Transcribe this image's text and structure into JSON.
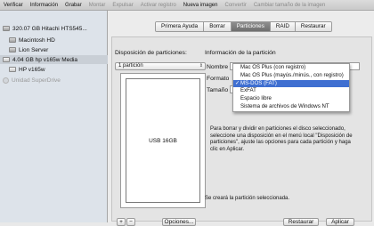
{
  "toolbar": {
    "items": [
      {
        "label": "Verificar",
        "enabled": true
      },
      {
        "label": "Información",
        "enabled": true
      },
      {
        "label": "Grabar",
        "enabled": true
      },
      {
        "label": "Montar",
        "enabled": false
      },
      {
        "label": "Expulsar",
        "enabled": false
      },
      {
        "label": "Activar registro",
        "enabled": false
      },
      {
        "label": "Nueva imagen",
        "enabled": true
      },
      {
        "label": "Convertir",
        "enabled": false
      },
      {
        "label": "Cambiar tamaño de la imagen",
        "enabled": false
      }
    ]
  },
  "sidebar": {
    "items": [
      {
        "label": "320.07 GB Hitachi HTS545...",
        "icon": "hard-disk-icon"
      },
      {
        "label": "Macintosh HD",
        "icon": "volume-icon"
      },
      {
        "label": "Lion Server",
        "icon": "volume-icon"
      },
      {
        "label": "4.04 GB hp v165w Media",
        "icon": "usb-drive-icon"
      },
      {
        "label": "HP v165w",
        "icon": "volume-icon"
      },
      {
        "label": "Unidad SuperDrive",
        "icon": "optical-drive-icon"
      }
    ]
  },
  "tabs": [
    "Primera Ayuda",
    "Borrar",
    "Particiones",
    "RAID",
    "Restaurar"
  ],
  "partition": {
    "layout_heading": "Disposición de particiones:",
    "layout_value": "1 partición",
    "partition_label": "USB 16GB",
    "info_heading": "Información de la partición",
    "name_label": "Nombre",
    "format_label": "Formato",
    "size_label": "Tamaño",
    "description": "Para borrar y dividir en particiones el disco seleccionado, seleccione una disposición en el menú local \"Disposición de particiones\", ajuste las opciones para cada partición y haga clic en Aplicar.",
    "status": "Se creará la partición seleccionada.",
    "add_label": "+",
    "remove_label": "−",
    "options_label": "Opciones...",
    "revert_label": "Restaurar",
    "apply_label": "Aplicar"
  },
  "format_menu": {
    "items": [
      "Mac OS Plus (con registro)",
      "Mac OS Plus (mayús./minús., con registro)",
      "MS-DOS (FAT)",
      "ExFAT",
      "Espacio libre",
      "Sistema de archivos de Windows NT"
    ],
    "selected": "MS-DOS (FAT)",
    "check": "✓"
  },
  "colors": {
    "selection": "#3f6fd1",
    "active_tab": "#7a7a7a"
  }
}
